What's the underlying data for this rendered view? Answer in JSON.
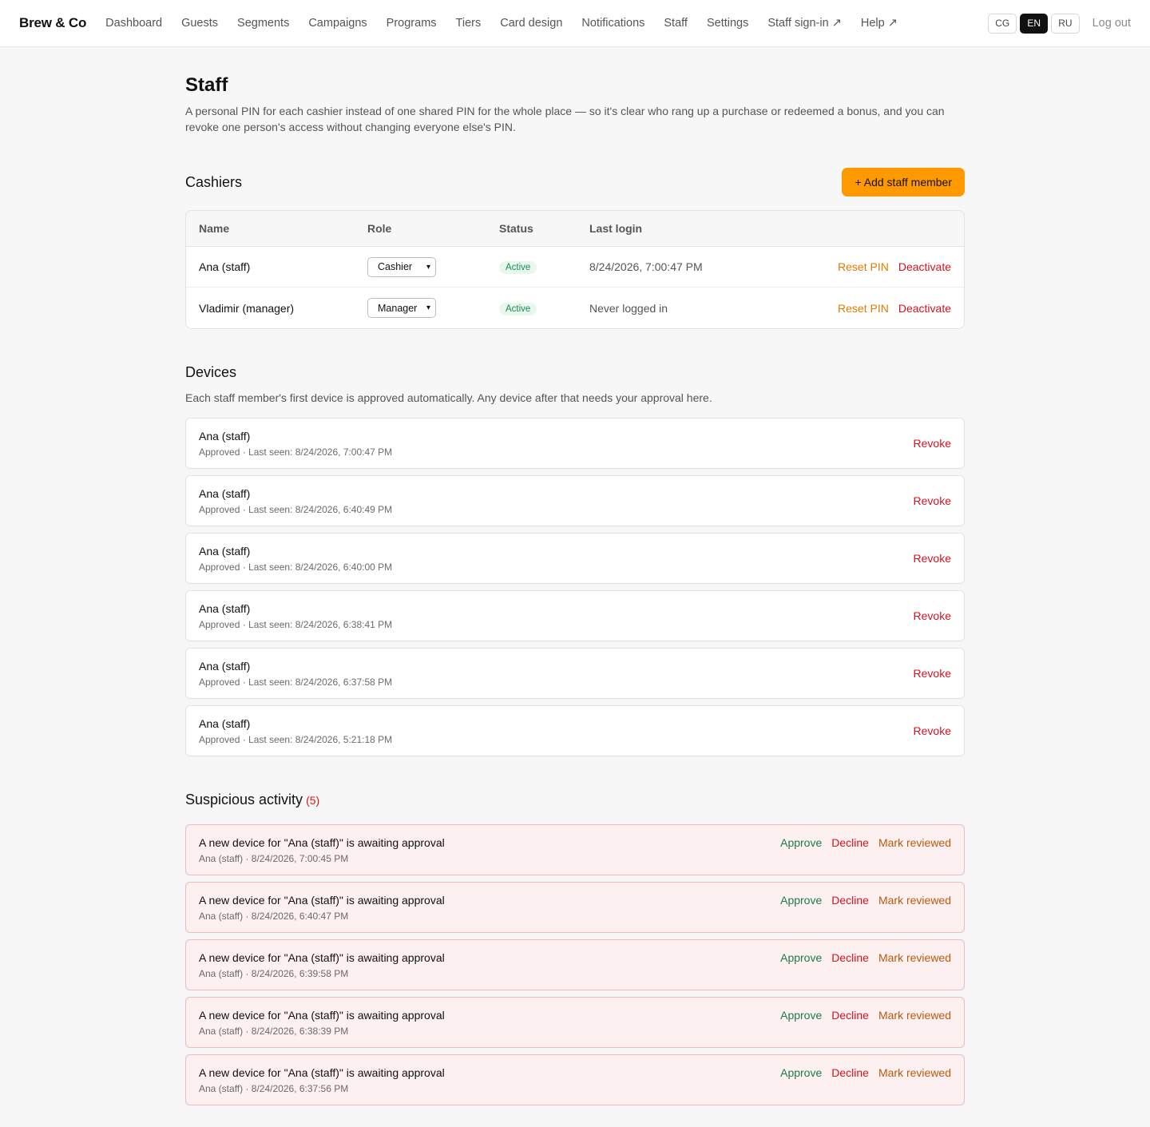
{
  "nav": {
    "brand": "Brew & Co",
    "links": [
      "Dashboard",
      "Guests",
      "Segments",
      "Campaigns",
      "Programs",
      "Tiers",
      "Card design",
      "Notifications",
      "Staff",
      "Settings",
      "Staff sign-in ↗",
      "Help ↗"
    ],
    "languages": [
      "CG",
      "EN",
      "RU"
    ],
    "active_language": "EN",
    "logout": "Log out"
  },
  "page": {
    "title": "Staff",
    "description": "A personal PIN for each cashier instead of one shared PIN for the whole place — so it's clear who rang up a purchase or redeemed a bonus, and you can revoke one person's access without changing everyone else's PIN."
  },
  "cashiers": {
    "title": "Cashiers",
    "add_button": "+ Add staff member",
    "columns": [
      "Name",
      "Role",
      "Status",
      "Last login"
    ],
    "rows": [
      {
        "name": "Ana (staff)",
        "role": "Cashier",
        "status": "Active",
        "last_login": "8/24/2026, 7:00:47 PM",
        "reset": "Reset PIN",
        "deactivate": "Deactivate"
      },
      {
        "name": "Vladimir (manager)",
        "role": "Manager",
        "status": "Active",
        "last_login": "Never logged in",
        "reset": "Reset PIN",
        "deactivate": "Deactivate"
      }
    ]
  },
  "devices": {
    "title": "Devices",
    "subtitle": "Each staff member's first device is approved automatically. Any device after that needs your approval here.",
    "items": [
      {
        "name": "Ana (staff)",
        "meta": "Approved · Last seen: 8/24/2026, 7:00:47 PM",
        "action": "Revoke"
      },
      {
        "name": "Ana (staff)",
        "meta": "Approved · Last seen: 8/24/2026, 6:40:49 PM",
        "action": "Revoke"
      },
      {
        "name": "Ana (staff)",
        "meta": "Approved · Last seen: 8/24/2026, 6:40:00 PM",
        "action": "Revoke"
      },
      {
        "name": "Ana (staff)",
        "meta": "Approved · Last seen: 8/24/2026, 6:38:41 PM",
        "action": "Revoke"
      },
      {
        "name": "Ana (staff)",
        "meta": "Approved · Last seen: 8/24/2026, 6:37:58 PM",
        "action": "Revoke"
      },
      {
        "name": "Ana (staff)",
        "meta": "Approved · Last seen: 8/24/2026, 5:21:18 PM",
        "action": "Revoke"
      }
    ]
  },
  "suspicious": {
    "title": "Suspicious activity",
    "count": "(5)",
    "items": [
      {
        "title": "A new device for \"Ana (staff)\" is awaiting approval",
        "meta": "Ana (staff) · 8/24/2026, 7:00:45 PM",
        "approve": "Approve",
        "decline": "Decline",
        "mark": "Mark reviewed"
      },
      {
        "title": "A new device for \"Ana (staff)\" is awaiting approval",
        "meta": "Ana (staff) · 8/24/2026, 6:40:47 PM",
        "approve": "Approve",
        "decline": "Decline",
        "mark": "Mark reviewed"
      },
      {
        "title": "A new device for \"Ana (staff)\" is awaiting approval",
        "meta": "Ana (staff) · 8/24/2026, 6:39:58 PM",
        "approve": "Approve",
        "decline": "Decline",
        "mark": "Mark reviewed"
      },
      {
        "title": "A new device for \"Ana (staff)\" is awaiting approval",
        "meta": "Ana (staff) · 8/24/2026, 6:38:39 PM",
        "approve": "Approve",
        "decline": "Decline",
        "mark": "Mark reviewed"
      },
      {
        "title": "A new device for \"Ana (staff)\" is awaiting approval",
        "meta": "Ana (staff) · 8/24/2026, 6:37:56 PM",
        "approve": "Approve",
        "decline": "Decline",
        "mark": "Mark reviewed"
      }
    ]
  },
  "colors": {
    "accent": "#ff9900",
    "danger": "#d0141f",
    "success": "#1d7a46",
    "warning_link": "#e07b00"
  }
}
